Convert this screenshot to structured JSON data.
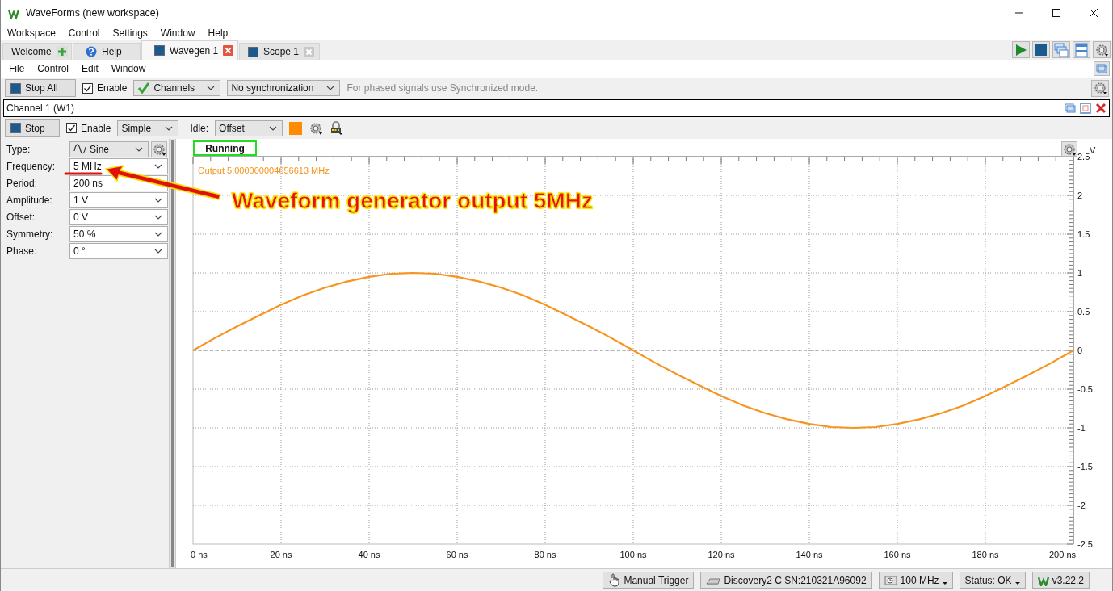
{
  "window": {
    "title": "WaveForms (new workspace)"
  },
  "menu": [
    "Workspace",
    "Control",
    "Settings",
    "Window",
    "Help"
  ],
  "tabs": [
    {
      "label": "Welcome",
      "kind": "welcome",
      "selected": false
    },
    {
      "label": "Help",
      "kind": "help",
      "selected": false
    },
    {
      "label": "Wavegen 1",
      "kind": "instrument",
      "selected": true
    },
    {
      "label": "Scope 1",
      "kind": "instrument",
      "selected": false
    }
  ],
  "instrument_menu": [
    "File",
    "Control",
    "Edit",
    "Window"
  ],
  "toolbar": {
    "stop_button": "Stop All",
    "enable": {
      "label": "Enable",
      "checked": true
    },
    "channels": "Channels",
    "sync": "No synchronization",
    "hint": "For phased signals use Synchronized mode."
  },
  "channel": {
    "title": "Channel 1 (W1)",
    "stop_button": "Stop",
    "enable": {
      "label": "Enable",
      "checked": true
    },
    "mode": "Simple",
    "idle_label": "Idle:",
    "idle": "Offset",
    "color": "#ff8c00"
  },
  "params": [
    {
      "label": "Type:",
      "value": "Sine",
      "kind": "waveform"
    },
    {
      "label": "Frequency:",
      "value": "5 MHz",
      "kind": "value"
    },
    {
      "label": "Period:",
      "value": "200 ns",
      "kind": "value"
    },
    {
      "label": "Amplitude:",
      "value": "1 V",
      "kind": "value"
    },
    {
      "label": "Offset:",
      "value": "0 V",
      "kind": "value"
    },
    {
      "label": "Symmetry:",
      "value": "50 %",
      "kind": "value"
    },
    {
      "label": "Phase:",
      "value": "0 °",
      "kind": "value"
    }
  ],
  "plot": {
    "status": "Running",
    "readout": "Output 5.000000004656613 MHz",
    "chart_data": {
      "type": "line",
      "ylabel": "V",
      "x": [
        0,
        5,
        10,
        15,
        20,
        25,
        30,
        35,
        40,
        45,
        50,
        55,
        60,
        65,
        70,
        75,
        80,
        85,
        90,
        95,
        100,
        105,
        110,
        115,
        120,
        125,
        130,
        135,
        140,
        145,
        150,
        155,
        160,
        165,
        170,
        175,
        180,
        185,
        190,
        195,
        200
      ],
      "series": [
        {
          "color": "#f7941d",
          "values": [
            0,
            0.16,
            0.31,
            0.45,
            0.59,
            0.71,
            0.81,
            0.89,
            0.95,
            0.99,
            1,
            0.99,
            0.95,
            0.89,
            0.81,
            0.71,
            0.59,
            0.45,
            0.31,
            0.16,
            0,
            -0.16,
            -0.31,
            -0.45,
            -0.59,
            -0.71,
            -0.81,
            -0.89,
            -0.95,
            -0.99,
            -1,
            -0.99,
            -0.95,
            -0.89,
            -0.81,
            -0.71,
            -0.59,
            -0.45,
            -0.31,
            -0.16,
            0
          ]
        }
      ],
      "xlim": [
        0,
        200
      ],
      "ylim": [
        -2.5,
        2.5
      ],
      "grid": true,
      "ref_lines": [
        {
          "axis": "y",
          "value": 0
        }
      ],
      "xticks": [
        {
          "value": 0,
          "label": "0 ns"
        },
        {
          "value": 20,
          "label": "20 ns"
        },
        {
          "value": 40,
          "label": "40 ns"
        },
        {
          "value": 60,
          "label": "60 ns"
        },
        {
          "value": 80,
          "label": "80 ns"
        },
        {
          "value": 100,
          "label": "100 ns"
        },
        {
          "value": 120,
          "label": "120 ns"
        },
        {
          "value": 140,
          "label": "140 ns"
        },
        {
          "value": 160,
          "label": "160 ns"
        },
        {
          "value": 180,
          "label": "180 ns"
        },
        {
          "value": 200,
          "label": "200 ns"
        }
      ],
      "yticks": [
        2.5,
        2,
        1.5,
        1,
        0.5,
        0,
        -0.5,
        -1,
        -1.5,
        -2,
        -2.5
      ]
    }
  },
  "annotation": {
    "text": "Waveform generator output 5MHz"
  },
  "status_bar": [
    {
      "label": "Manual Trigger",
      "kind": "trigger"
    },
    {
      "label": "Discovery2 C SN:210321A96092",
      "kind": "device"
    },
    {
      "label": "100 MHz",
      "kind": "clock"
    },
    {
      "label": "Status: OK",
      "kind": "status"
    },
    {
      "label": "v3.22.2",
      "kind": "version"
    }
  ]
}
